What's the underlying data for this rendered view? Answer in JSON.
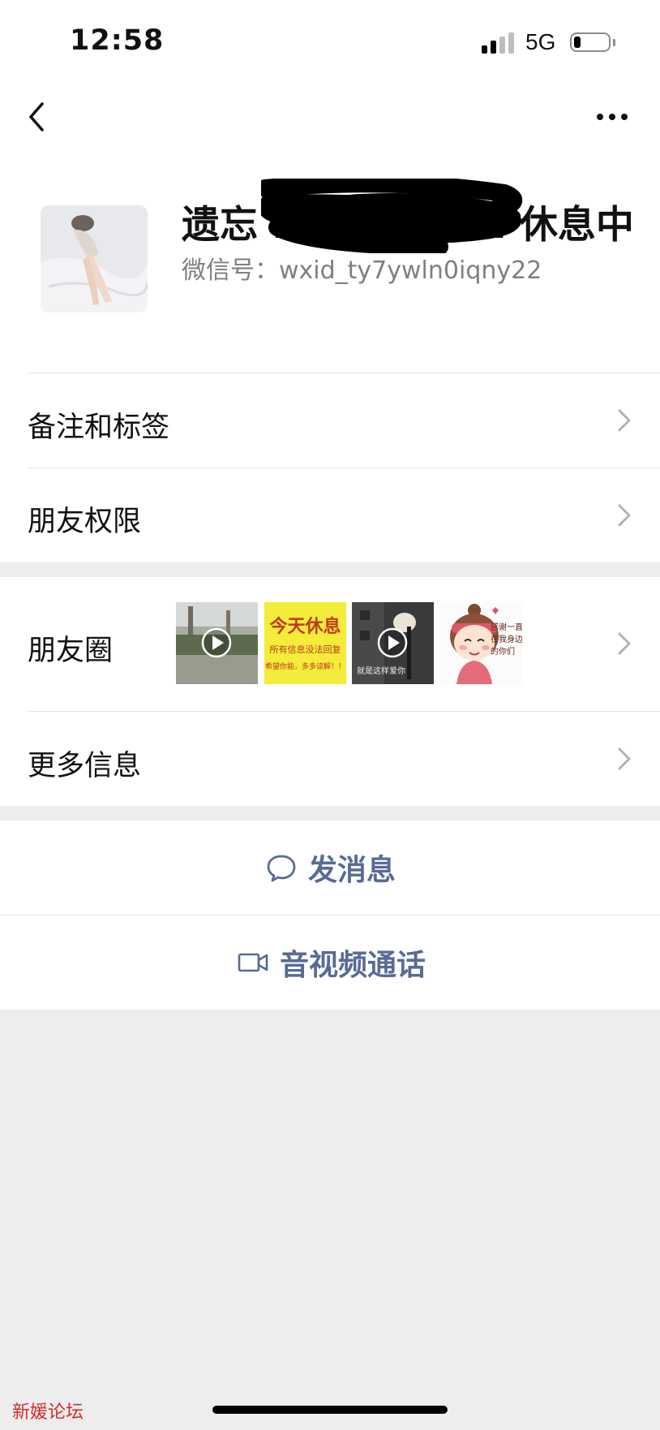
{
  "status_bar": {
    "time": "12:58",
    "network": "5G",
    "battery_level": 0.2
  },
  "profile": {
    "name": "遗忘 18",
    "name_end": "2 休息中",
    "wechat_id": "微信号：wxid_ty7ywln0iqny22",
    "avatar_icon": "avatar-photo"
  },
  "rows": {
    "remarks": "备注和标签",
    "permissions": "朋友权限",
    "moments": "朋友圈",
    "more_info": "更多信息"
  },
  "moments_thumbs": {
    "t2_title": "今天休息",
    "t2_line1": "所有信息没法回复",
    "t2_line2": "希望你能，多多谅解！！",
    "t3_caption": "就是这样爱你",
    "t4_text": "感谢一直在我身边的你们"
  },
  "actions": {
    "send_message": "发消息",
    "call": "音视频通话"
  },
  "watermark": "新媛论坛",
  "colors": {
    "link": "#576b95",
    "background": "#ededed",
    "watermark": "#d0302b"
  }
}
